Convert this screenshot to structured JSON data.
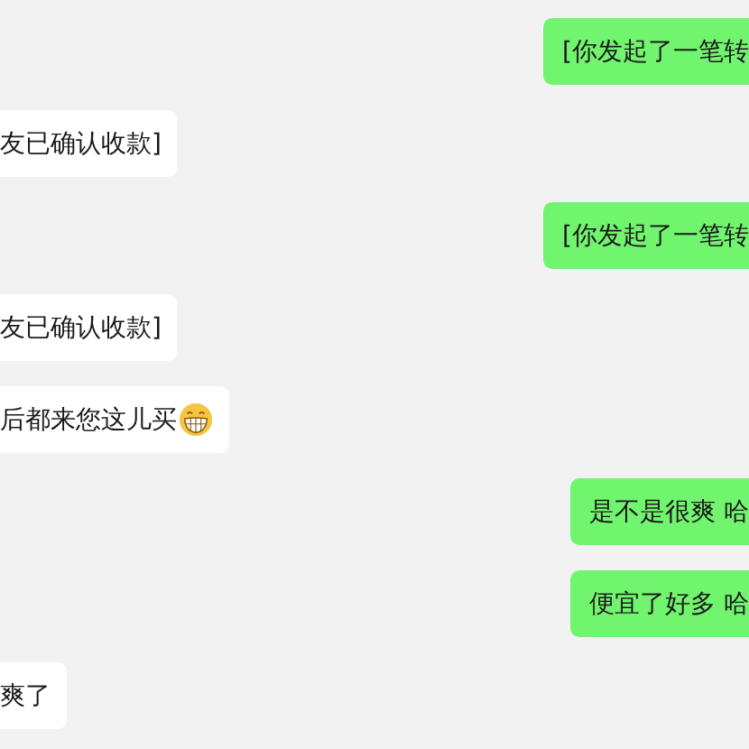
{
  "messages": [
    {
      "kind": "sent",
      "text": "[你发起了一笔转"
    },
    {
      "kind": "received",
      "text": "友已确认收款]"
    },
    {
      "kind": "sent",
      "text": "[你发起了一笔转"
    },
    {
      "kind": "received",
      "text": "友已确认收款]"
    },
    {
      "kind": "received",
      "text": "后都来您这儿买",
      "emoji": true
    },
    {
      "kind": "sent",
      "text": "是不是很爽 哈"
    },
    {
      "kind": "sent",
      "text": "便宜了好多 哈"
    },
    {
      "kind": "received",
      "text": "爽了"
    }
  ]
}
